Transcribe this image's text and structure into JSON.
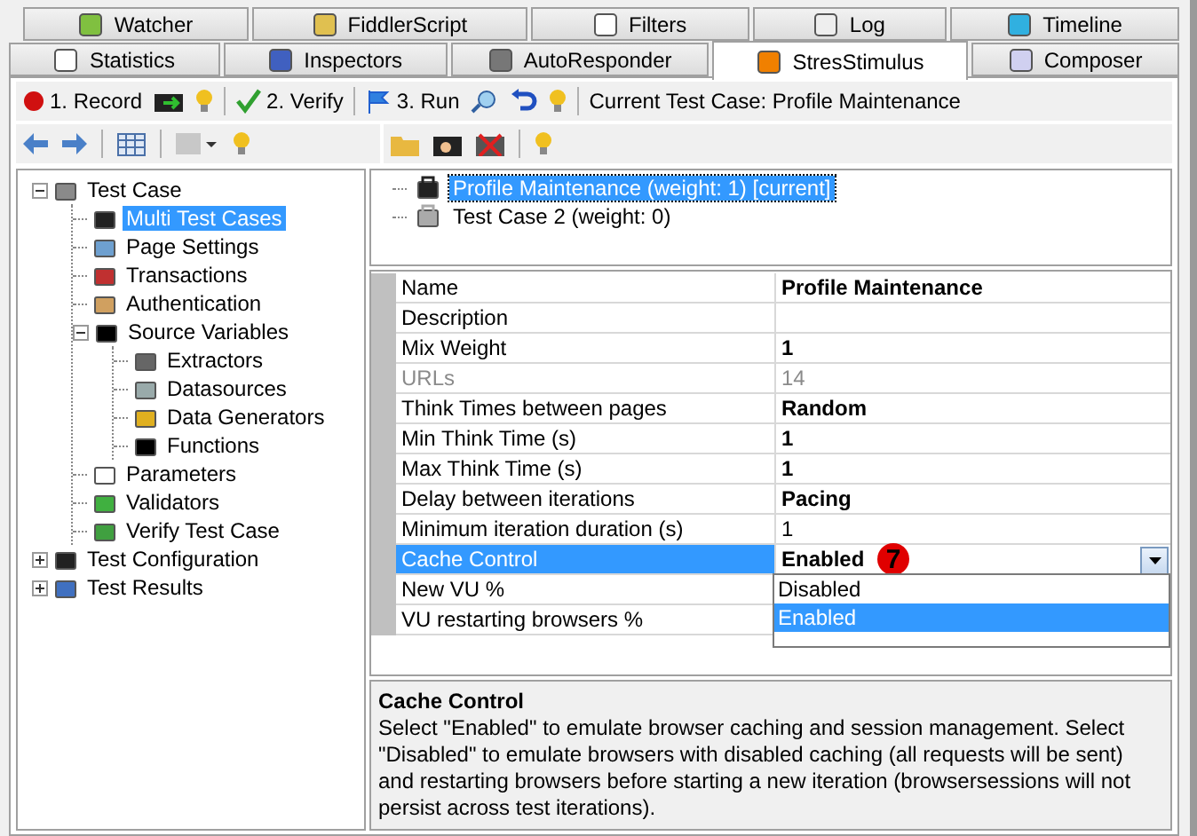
{
  "tabs_row1": [
    {
      "label": "Watcher",
      "selected": false
    },
    {
      "label": "FiddlerScript",
      "selected": false
    },
    {
      "label": "Filters",
      "selected": false
    },
    {
      "label": "Log",
      "selected": false
    },
    {
      "label": "Timeline",
      "selected": false
    }
  ],
  "tabs_row2": [
    {
      "label": "Statistics",
      "selected": false
    },
    {
      "label": "Inspectors",
      "selected": false
    },
    {
      "label": "AutoResponder",
      "selected": false
    },
    {
      "label": "StresStimulus",
      "selected": true
    },
    {
      "label": "Composer",
      "selected": false
    }
  ],
  "toolbar": {
    "record": "1. Record",
    "verify": "2. Verify",
    "run": "3. Run",
    "current_test_case": "Current Test Case: Profile Maintenance"
  },
  "tree": [
    {
      "label": "Test Case",
      "expanded": true,
      "selected": false,
      "children": [
        {
          "label": "Multi Test Cases",
          "selected": true
        },
        {
          "label": "Page Settings",
          "selected": false
        },
        {
          "label": "Transactions",
          "selected": false
        },
        {
          "label": "Authentication",
          "selected": false
        },
        {
          "label": "Source Variables",
          "expanded": true,
          "selected": false,
          "children": [
            {
              "label": "Extractors",
              "selected": false
            },
            {
              "label": "Datasources",
              "selected": false
            },
            {
              "label": "Data Generators",
              "selected": false
            },
            {
              "label": "Functions",
              "selected": false
            }
          ]
        },
        {
          "label": "Parameters",
          "selected": false
        },
        {
          "label": "Validators",
          "selected": false
        },
        {
          "label": "Verify Test Case",
          "selected": false
        }
      ]
    },
    {
      "label": "Test Configuration",
      "expanded": false,
      "selected": false
    },
    {
      "label": "Test Results",
      "expanded": false,
      "selected": false
    }
  ],
  "test_cases": [
    {
      "label": "Profile Maintenance (weight: 1) [current]",
      "selected": true
    },
    {
      "label": "Test Case 2 (weight: 0)",
      "selected": false
    }
  ],
  "properties": [
    {
      "name": "Name",
      "value": "Profile Maintenance",
      "bold": true,
      "disabled": false,
      "selected": false
    },
    {
      "name": "Description",
      "disabled": false,
      "selected": false
    },
    {
      "name": "Mix Weight",
      "value": "1",
      "bold": true,
      "disabled": false,
      "selected": false
    },
    {
      "name": "URLs",
      "value": "14",
      "bold": false,
      "disabled": true,
      "selected": false
    },
    {
      "name": "Think Times between pages",
      "value": "Random",
      "bold": true,
      "disabled": false,
      "selected": false
    },
    {
      "name": "Min Think Time (s)",
      "value": "1",
      "bold": true,
      "disabled": false,
      "selected": false
    },
    {
      "name": "Max Think Time (s)",
      "value": "1",
      "bold": true,
      "disabled": false,
      "selected": false
    },
    {
      "name": "Delay between iterations",
      "value": "Pacing",
      "bold": true,
      "disabled": false,
      "selected": false
    },
    {
      "name": "Minimum iteration duration (s)",
      "value": "1",
      "bold": false,
      "disabled": false,
      "selected": false
    },
    {
      "name": "Cache Control",
      "value": "Enabled",
      "bold": true,
      "disabled": false,
      "selected": true,
      "badge": "7",
      "dropdown": {
        "options": [
          {
            "label": "Disabled",
            "selected": false
          },
          {
            "label": "Enabled",
            "selected": true
          }
        ]
      }
    },
    {
      "name": "New VU %",
      "disabled": false,
      "selected": false
    },
    {
      "name": "VU restarting browsers %",
      "disabled": false,
      "selected": false
    }
  ],
  "description": {
    "title": "Cache Control",
    "text": "Select \"Enabled\" to emulate browser caching and session management. Select \"Disabled\" to emulate browsers with disabled caching (all requests will be sent) and restarting browsers before starting a new iteration (browsersessions will not persist across test iterations)."
  }
}
